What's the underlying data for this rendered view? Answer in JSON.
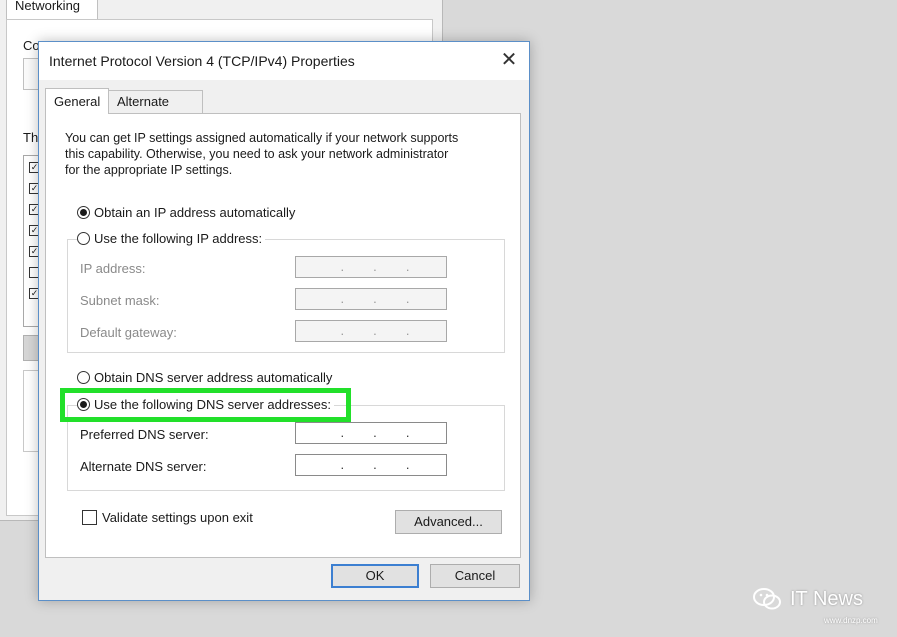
{
  "background_window": {
    "tab_label": "Networking",
    "connect_label": "Co",
    "this_label": "Th"
  },
  "dialog": {
    "title": "Internet Protocol Version 4 (TCP/IPv4) Properties",
    "close_symbol": "✕",
    "tabs": [
      {
        "label": "General",
        "active": true
      },
      {
        "label": "Alternate Configuration",
        "active": false
      }
    ],
    "intro_text": "You can get IP settings assigned automatically if your network supports\nthis capability. Otherwise, you need to ask your network administrator\nfor the appropriate IP settings.",
    "ip": {
      "auto_label": "Obtain an IP address automatically",
      "manual_label": "Use the following IP address:",
      "selected": "auto",
      "fields": [
        {
          "label": "IP address:",
          "value": ". . ."
        },
        {
          "label": "Subnet mask:",
          "value": ". . ."
        },
        {
          "label": "Default gateway:",
          "value": ". . ."
        }
      ]
    },
    "dns": {
      "auto_label": "Obtain DNS server address automatically",
      "manual_label": "Use the following DNS server addresses:",
      "selected": "manual",
      "fields": [
        {
          "label": "Preferred DNS server:",
          "value": ". . ."
        },
        {
          "label": "Alternate DNS server:",
          "value": ". . ."
        }
      ]
    },
    "validate_label": "Validate settings upon exit",
    "validate_checked": false,
    "advanced_label": "Advanced...",
    "ok_label": "OK",
    "cancel_label": "Cancel"
  },
  "highlight_color": "#22e02a",
  "watermark": {
    "icon": "wechat-icon",
    "text": "IT News",
    "site": "www.dnzp.com"
  }
}
